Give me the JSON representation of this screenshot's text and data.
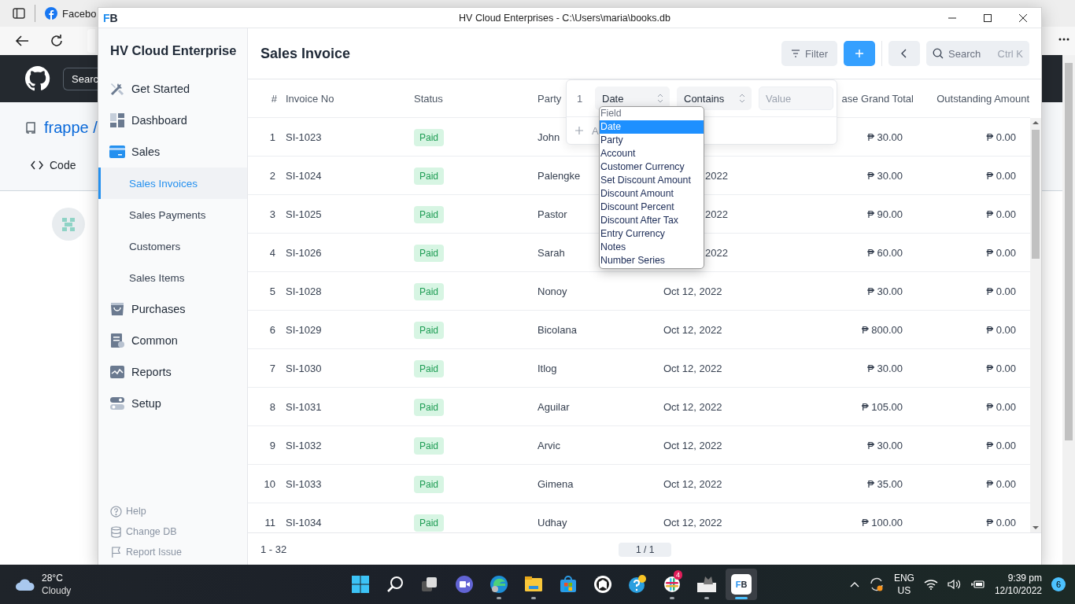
{
  "browser": {
    "tab_title": "Facebo",
    "search_placeholder": "Searc",
    "repo": "frappe /",
    "repo_tab": "Code"
  },
  "window": {
    "logo_first": "F",
    "logo_second": "B",
    "title": "HV Cloud Enterprises - C:\\Users\\maria\\books.db"
  },
  "sidebar": {
    "company": "HV Cloud Enterprise",
    "items": [
      {
        "label": "Get Started",
        "selected": false
      },
      {
        "label": "Dashboard",
        "selected": false
      },
      {
        "label": "Sales",
        "selected": false,
        "expanded": true,
        "children": [
          {
            "label": "Sales Invoices",
            "selected": true
          },
          {
            "label": "Sales Payments",
            "selected": false
          },
          {
            "label": "Customers",
            "selected": false
          },
          {
            "label": "Sales Items",
            "selected": false
          }
        ]
      },
      {
        "label": "Purchases",
        "selected": false
      },
      {
        "label": "Common",
        "selected": false
      },
      {
        "label": "Reports",
        "selected": false
      },
      {
        "label": "Setup",
        "selected": false
      }
    ],
    "footer": [
      "Help",
      "Change DB",
      "Report Issue"
    ]
  },
  "page": {
    "title": "Sales Invoice",
    "filter_button": "Filter",
    "search_label": "Search",
    "search_shortcut": "Ctrl K"
  },
  "table": {
    "columns": [
      "#",
      "Invoice No",
      "Status",
      "Party",
      "ase Grand Total",
      "Outstanding Amount"
    ],
    "rows": [
      {
        "no": "1",
        "invoice": "SI-1023",
        "status": "Paid",
        "party": "John",
        "total": "₱ 30.00",
        "outstanding": "₱ 0.00"
      },
      {
        "no": "2",
        "invoice": "SI-1024",
        "status": "Paid",
        "party": "Palengke",
        "date": "2022",
        "date_cut": true,
        "total": "₱ 30.00",
        "outstanding": "₱ 0.00"
      },
      {
        "no": "3",
        "invoice": "SI-1025",
        "status": "Paid",
        "party": "Pastor",
        "date": "2022",
        "date_cut": true,
        "total": "₱ 90.00",
        "outstanding": "₱ 0.00"
      },
      {
        "no": "4",
        "invoice": "SI-1026",
        "status": "Paid",
        "party": "Sarah",
        "date": "2022",
        "date_cut": true,
        "total": "₱ 60.00",
        "outstanding": "₱ 0.00"
      },
      {
        "no": "5",
        "invoice": "SI-1028",
        "status": "Paid",
        "party": "Nonoy",
        "date": "Oct 12, 2022",
        "total": "₱ 30.00",
        "outstanding": "₱ 0.00"
      },
      {
        "no": "6",
        "invoice": "SI-1029",
        "status": "Paid",
        "party": "Bicolana",
        "date": "Oct 12, 2022",
        "total": "₱ 800.00",
        "outstanding": "₱ 0.00"
      },
      {
        "no": "7",
        "invoice": "SI-1030",
        "status": "Paid",
        "party": "Itlog",
        "date": "Oct 12, 2022",
        "total": "₱ 30.00",
        "outstanding": "₱ 0.00"
      },
      {
        "no": "8",
        "invoice": "SI-1031",
        "status": "Paid",
        "party": "Aguilar",
        "date": "Oct 12, 2022",
        "total": "₱ 105.00",
        "outstanding": "₱ 0.00"
      },
      {
        "no": "9",
        "invoice": "SI-1032",
        "status": "Paid",
        "party": "Arvic",
        "date": "Oct 12, 2022",
        "total": "₱ 30.00",
        "outstanding": "₱ 0.00"
      },
      {
        "no": "10",
        "invoice": "SI-1033",
        "status": "Paid",
        "party": "Gimena",
        "date": "Oct 12, 2022",
        "total": "₱ 35.00",
        "outstanding": "₱ 0.00"
      },
      {
        "no": "11",
        "invoice": "SI-1034",
        "status": "Paid",
        "party": "Udhay",
        "date": "Oct 12, 2022",
        "total": "₱ 100.00",
        "outstanding": "₱ 0.00"
      }
    ],
    "range": "1 - 32",
    "pages": "1 / 1"
  },
  "filter": {
    "row_no": "1",
    "field": "Date",
    "operator": "Contains",
    "value_placeholder": "Value",
    "add_label": "A",
    "options": [
      {
        "label": "Field",
        "selected": false,
        "disabled": true
      },
      {
        "label": "Date",
        "selected": true,
        "disabled": false
      },
      {
        "label": "Party",
        "selected": false,
        "disabled": false
      },
      {
        "label": "Account",
        "selected": false,
        "disabled": false
      },
      {
        "label": "Customer Currency",
        "selected": false,
        "disabled": false
      },
      {
        "label": "Set Discount Amount",
        "selected": false,
        "disabled": false
      },
      {
        "label": "Discount Amount",
        "selected": false,
        "disabled": false
      },
      {
        "label": "Discount Percent",
        "selected": false,
        "disabled": false
      },
      {
        "label": "Discount After Tax",
        "selected": false,
        "disabled": false
      },
      {
        "label": "Entry Currency",
        "selected": false,
        "disabled": false
      },
      {
        "label": "Notes",
        "selected": false,
        "disabled": false
      },
      {
        "label": "Number Series",
        "selected": false,
        "disabled": false
      }
    ]
  },
  "taskbar": {
    "weather": {
      "temp": "28°C",
      "desc": "Cloudy"
    },
    "apps": [
      {
        "running": false,
        "active": false
      },
      {
        "running": false,
        "active": false
      },
      {
        "running": false,
        "active": false
      },
      {
        "running": false,
        "active": false
      },
      {
        "running": true,
        "active": false
      },
      {
        "running": true,
        "active": false
      },
      {
        "running": false,
        "active": false
      },
      {
        "running": false,
        "active": false
      },
      {
        "running": false,
        "active": false
      },
      {
        "running": true,
        "active": false,
        "badge": "4"
      },
      {
        "running": true,
        "active": false
      },
      {
        "running": true,
        "active": true,
        "text_first": "F",
        "text_second": "B"
      }
    ],
    "lang": "ENG",
    "region": "US",
    "time": "9:39 pm",
    "date": "12/10/2022",
    "notifications": "6"
  }
}
